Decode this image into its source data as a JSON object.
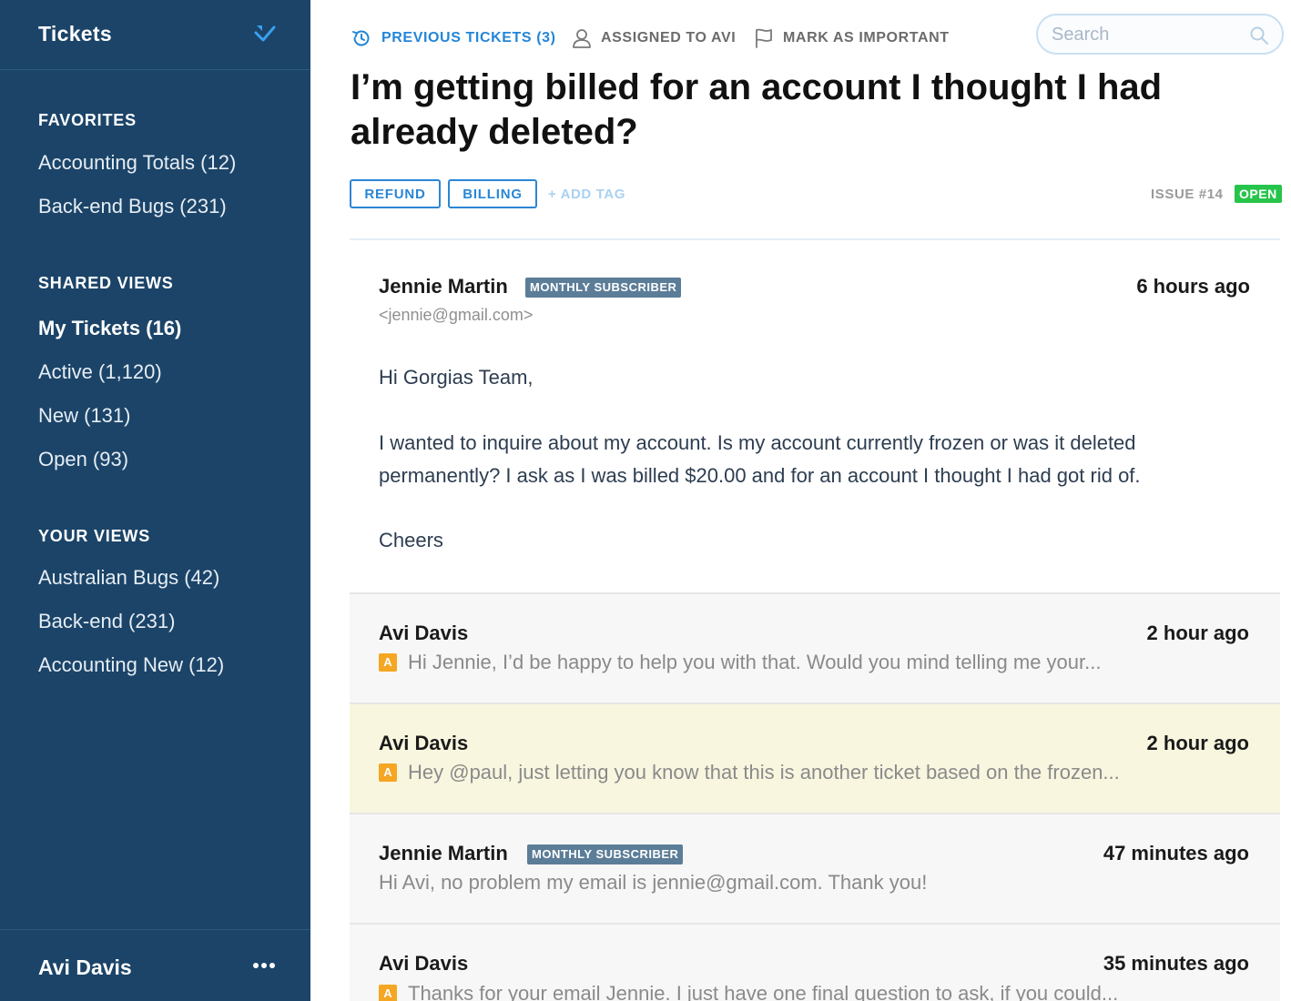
{
  "sidebar": {
    "title": "Tickets",
    "sections": [
      {
        "heading": "FAVORITES",
        "items": [
          "Accounting Totals (12)",
          "Back-end Bugs (231)"
        ]
      },
      {
        "heading": "SHARED VIEWS",
        "items": [
          "My Tickets (16)",
          "Active (1,120)",
          "New (131)",
          "Open (93)"
        ]
      },
      {
        "heading": "YOUR VIEWS",
        "items": [
          "Australian Bugs (42)",
          "Back-end (231)",
          "Accounting New (12)"
        ]
      }
    ],
    "active_item": "My Tickets (16)",
    "user_name": "Avi Davis"
  },
  "toolbar": {
    "previous_tickets": "PREVIOUS TICKETS (3)",
    "assigned": "ASSIGNED TO AVI",
    "mark_important": "MARK AS IMPORTANT",
    "search_placeholder": "Search"
  },
  "ticket": {
    "title": "I’m getting billed for an account I thought I had already deleted?",
    "tags": [
      "REFUND",
      "BILLING"
    ],
    "add_tag": "+ ADD TAG",
    "issue": "ISSUE #14",
    "status": "OPEN"
  },
  "first_message": {
    "author": "Jennie Martin",
    "badge": "MONTHLY SUBSCRIBER",
    "email": "<jennie@gmail.com>",
    "time": "6 hours ago",
    "greeting": "Hi Gorgias Team,",
    "body_line1": "I wanted to inquire about my account. Is my account currently frozen or was it deleted",
    "body_line2": "permanently? I ask as I was billed $20.00 and for an account I thought I had got rid of.",
    "signoff": "Cheers"
  },
  "thread": [
    {
      "author": "Avi Davis",
      "time": "2 hour ago",
      "agent_badge": "A",
      "preview": "Hi Jennie, I’d be happy to help you with that. Would you mind telling me your..."
    },
    {
      "author": "Avi Davis",
      "time": "2 hour ago",
      "agent_badge": "A",
      "preview": "Hey @paul, just letting you know that this is another ticket based on the frozen..."
    },
    {
      "author": "Jennie Martin",
      "badge": "MONTHLY SUBSCRIBER",
      "time": "47 minutes ago",
      "preview": "Hi Avi, no problem my email is jennie@gmail.com. Thank you!"
    },
    {
      "author": "Avi Davis",
      "time": "35 minutes ago",
      "agent_badge": "A",
      "preview": "Thanks for your email Jennie. I just have one final question to ask, if you could..."
    }
  ],
  "colors": {
    "sidebar_bg": "#1b4468",
    "accent": "#2386d8",
    "status_open": "#27c44c",
    "agent_badge": "#f5a623",
    "highlight_row": "#f8f6df"
  }
}
